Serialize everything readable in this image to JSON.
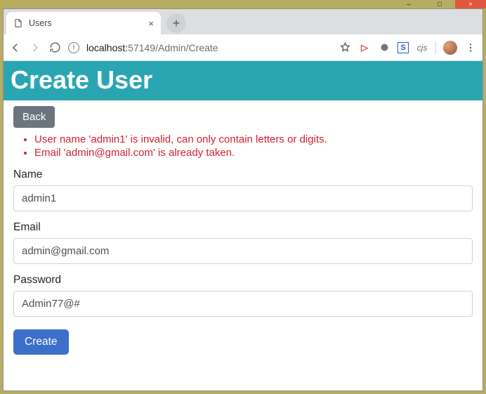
{
  "window": {
    "minimize": "–",
    "maximize": "□",
    "close": "×"
  },
  "browser": {
    "tab_title": "Users",
    "new_tab": "+",
    "url_host": "localhost:",
    "url_port_path": "57149/Admin/Create",
    "ext_cjs": "cjs"
  },
  "page": {
    "heading": "Create User",
    "back_label": "Back",
    "errors": [
      "User name 'admin1' is invalid, can only contain letters or digits.",
      "Email 'admin@gmail.com' is already taken."
    ],
    "fields": {
      "name": {
        "label": "Name",
        "value": "admin1"
      },
      "email": {
        "label": "Email",
        "value": "admin@gmail.com"
      },
      "password": {
        "label": "Password",
        "value": "Admin77@#"
      }
    },
    "submit_label": "Create"
  }
}
